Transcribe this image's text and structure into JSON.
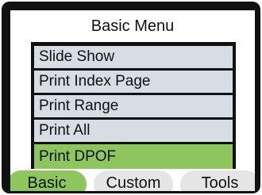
{
  "menu": {
    "title": "Basic Menu",
    "items": [
      {
        "label": "Slide Show",
        "selected": false
      },
      {
        "label": "Print Index Page",
        "selected": false
      },
      {
        "label": "Print Range",
        "selected": false
      },
      {
        "label": "Print All",
        "selected": false
      },
      {
        "label": "Print DPOF",
        "selected": true
      }
    ]
  },
  "tabs": [
    {
      "label": "Basic",
      "active": true
    },
    {
      "label": "Custom",
      "active": false
    },
    {
      "label": "Tools",
      "active": false
    }
  ],
  "colors": {
    "selected": "#8fc55e",
    "item_bg": "#d7dde5",
    "tab_bg": "#e5e5e5",
    "frame": "#111111"
  }
}
